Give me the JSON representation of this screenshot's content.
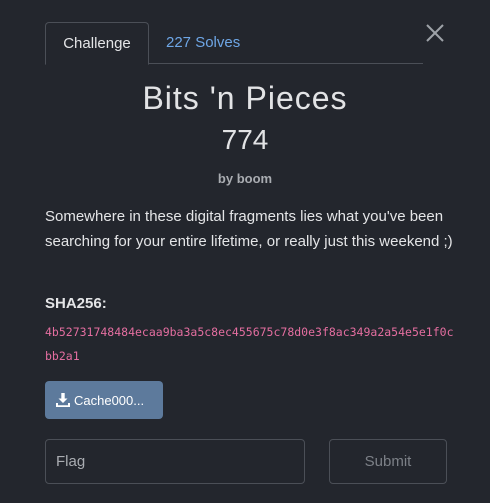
{
  "tabs": {
    "challenge": "Challenge",
    "solves": "227 Solves"
  },
  "challenge": {
    "name": "Bits 'n Pieces",
    "value": "774",
    "author": "by boom",
    "description": "Somewhere in these digital fragments lies what you've been searching for your entire lifetime, or really just this weekend ;)",
    "hash_label": "SHA256:",
    "hash": "4b52731748484ecaa9ba3a5c8ec455675c78d0e3f8ac349a2a54e5e1f0cbb2a1"
  },
  "download": {
    "label": "Cache000...",
    "icon": "download-icon"
  },
  "form": {
    "flag_placeholder": "Flag",
    "flag_value": "",
    "submit_label": "Submit"
  },
  "icons": {
    "close": "close-icon"
  },
  "colors": {
    "background": "#23262d",
    "link": "#6ea6e6",
    "hash": "#e46ea0",
    "download_button": "#5d7a9c"
  }
}
